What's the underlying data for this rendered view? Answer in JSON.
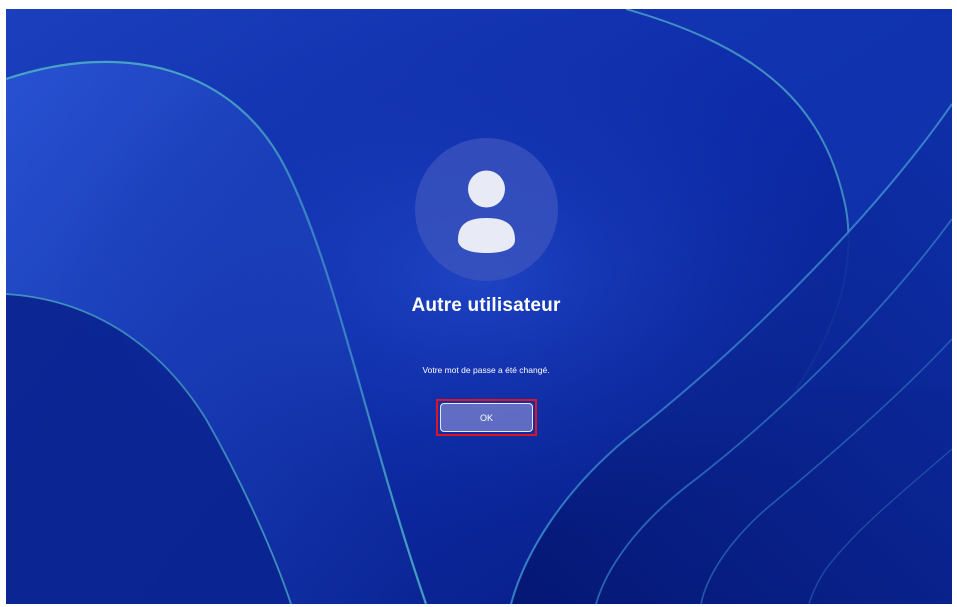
{
  "login": {
    "username": "Autre utilisateur",
    "message": "Votre mot de passe a été changé.",
    "ok_label": "OK"
  },
  "icons": {
    "avatar": "user-icon"
  },
  "colors": {
    "background": "#0b2aa3",
    "highlight_border": "#e0141c",
    "button_fill": "#6e78c8",
    "text": "#ffffff"
  }
}
